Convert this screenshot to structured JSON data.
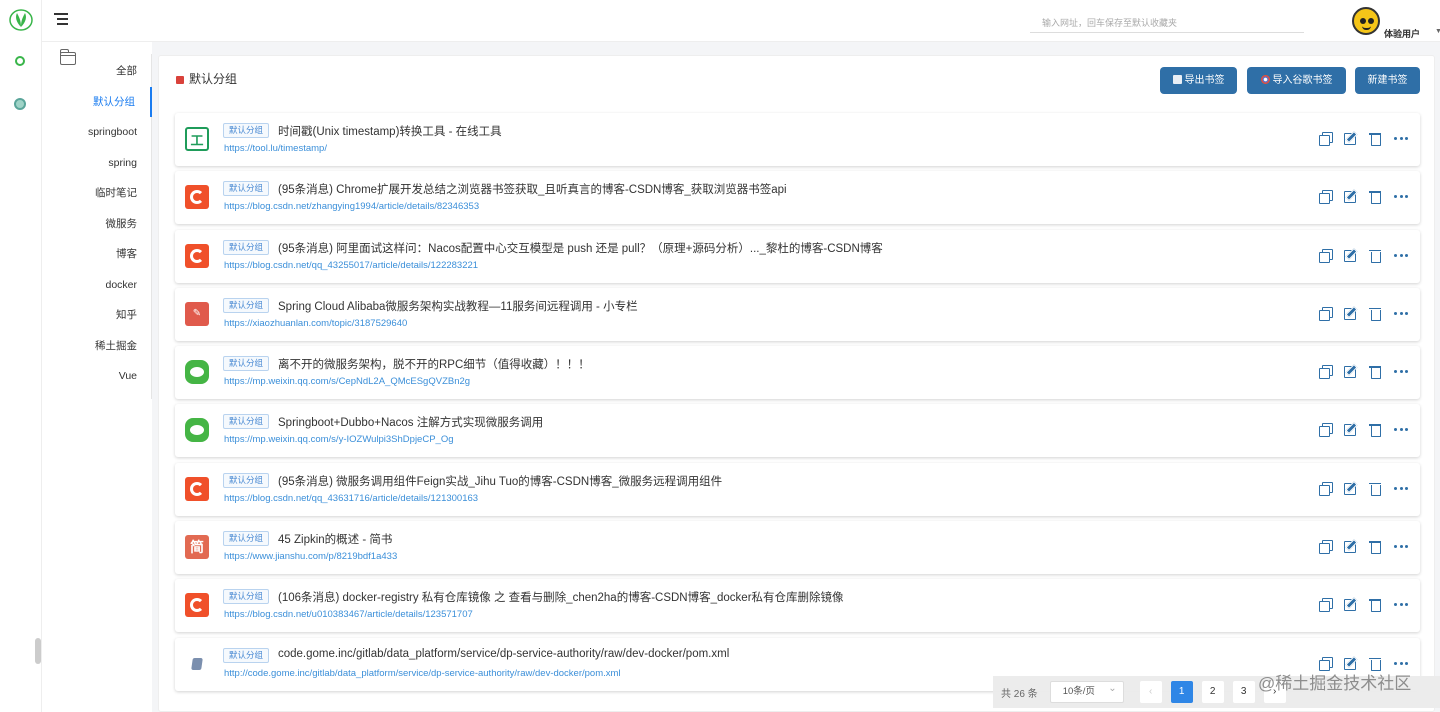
{
  "header": {
    "search_placeholder": "输入网址，回车保存至默认收藏夹",
    "username": "体验用户"
  },
  "groups": {
    "items": [
      "全部",
      "默认分组",
      "springboot",
      "spring",
      "临时笔记",
      "微服务",
      "博客",
      "docker",
      "知乎",
      "稀土掘金",
      "Vue"
    ],
    "active_index": 1
  },
  "panel": {
    "title": "默认分组",
    "buttons": {
      "export": "导出书签",
      "import": "导入谷歌书签",
      "new": "新建书签"
    }
  },
  "bookmarks": [
    {
      "icon": "tool-lu-icon",
      "tag": "默认分组",
      "title": "时间戳(Unix timestamp)转换工具 - 在线工具",
      "url": "https://tool.lu/timestamp/"
    },
    {
      "icon": "csdn-icon",
      "tag": "默认分组",
      "title": "(95条消息) Chrome扩展开发总结之浏览器书签获取_且听真言的博客-CSDN博客_获取浏览器书签api",
      "url": "https://blog.csdn.net/zhangying1994/article/details/82346353"
    },
    {
      "icon": "csdn-icon",
      "tag": "默认分组",
      "title": "(95条消息) 阿里面试这样问：Nacos配置中心交互模型是 push 还是 pull？（原理+源码分析）..._黎杜的博客-CSDN博客",
      "url": "https://blog.csdn.net/qq_43255017/article/details/122283221"
    },
    {
      "icon": "xiaozhuanlan-icon",
      "tag": "默认分组",
      "title": "Spring Cloud Alibaba微服务架构实战教程—11服务间远程调用  -  小专栏",
      "url": "https://xiaozhuanlan.com/topic/3187529640"
    },
    {
      "icon": "wechat-icon",
      "tag": "默认分组",
      "title": "离不开的微服务架构，脱不开的RPC细节（值得收藏）！！！",
      "url": "https://mp.weixin.qq.com/s/CepNdL2A_QMcESgQVZBn2g"
    },
    {
      "icon": "wechat-icon",
      "tag": "默认分组",
      "title": "Springboot+Dubbo+Nacos 注解方式实现微服务调用",
      "url": "https://mp.weixin.qq.com/s/y-IOZWulpi3ShDpjeCP_Og"
    },
    {
      "icon": "csdn-icon",
      "tag": "默认分组",
      "title": "(95条消息) 微服务调用组件Feign实战_Jihu Tuo的博客-CSDN博客_微服务远程调用组件",
      "url": "https://blog.csdn.net/qq_43631716/article/details/121300163"
    },
    {
      "icon": "jianshu-icon",
      "tag": "默认分组",
      "title": "45 Zipkin的概述 - 简书",
      "url": "https://www.jianshu.com/p/8219bdf1a433"
    },
    {
      "icon": "csdn-icon",
      "tag": "默认分组",
      "title": "(106条消息) docker-registry 私有仓库镜像 之 查看与删除_chen2ha的博客-CSDN博客_docker私有仓库删除镜像",
      "url": "https://blog.csdn.net/u010383467/article/details/123571707"
    },
    {
      "icon": "gitlab-icon",
      "tag": "默认分组",
      "title": "code.gome.inc/gitlab/data_platform/service/dp-service-authority/raw/dev-docker/pom.xml",
      "url": "http://code.gome.inc/gitlab/data_platform/service/dp-service-authority/raw/dev-docker/pom.xml"
    }
  ],
  "favicon_glyphs": {
    "tool-lu-icon": "工",
    "xiaozhuanlan-icon": "✎",
    "jianshu-icon": "简"
  },
  "pagination": {
    "total": "共 26 条",
    "page_size": "10条/页",
    "pages": [
      "1",
      "2",
      "3"
    ],
    "current": "1"
  },
  "watermark": "@稀土掘金技术社区",
  "colors": {
    "primary": "#2f6fa7",
    "accent": "#1a7cf0",
    "link": "#3b8fd9",
    "csdn": "#f0502a",
    "wechat": "#45b545"
  }
}
